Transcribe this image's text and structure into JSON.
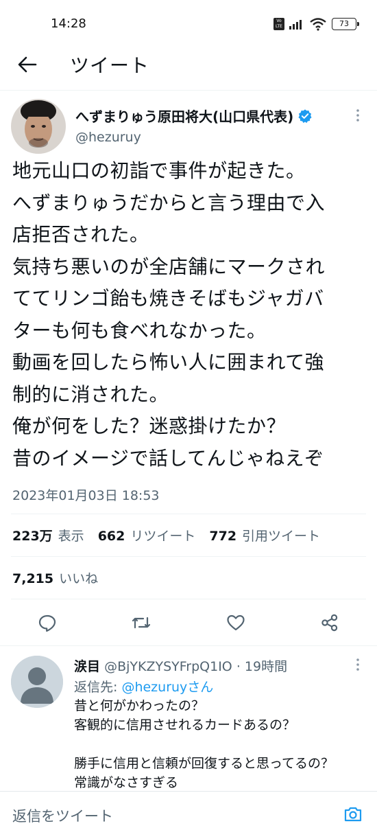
{
  "status_bar": {
    "time": "14:28",
    "volte": "Vo LTE",
    "battery": "73"
  },
  "topbar": {
    "title": "ツイート"
  },
  "tweet": {
    "author_name": "へずまりゅう原田将大(山口県代表)",
    "author_handle": "@hezuruy",
    "lines": [
      "地元山口の初詣で事件が起きた。",
      "へずまりゅうだからと言う理由で入",
      "店拒否された。",
      "気持ち悪いのが全店舗にマークされ",
      "ててリンゴ飴も焼きそばもジャガバ",
      "ターも何も食べれなかった。",
      "動画を回したら怖い人に囲まれて強",
      "制的に消された。",
      "俺が何をした？迷惑掛けたか？",
      "昔のイメージで話してんじゃねえぞ"
    ],
    "timestamp": "2023年01月03日 18:53",
    "stats": {
      "views_count": "223万",
      "views_label": "表示",
      "retweets_count": "662",
      "retweets_label": "リツイート",
      "quotes_count": "772",
      "quotes_label": "引用ツイート",
      "likes_count": "7,215",
      "likes_label": "いいね"
    },
    "accent_color": "#1d9bf0"
  },
  "reply": {
    "name": "涙目",
    "handle": "@BjYKZYSYFrpQ1IO",
    "time": "· 19時間",
    "reply_to_label": "返信先:",
    "reply_to_handle": "@hezuruyさん",
    "lines": [
      "昔と何がかわったの？",
      "客観的に信用させれるカードあるの？",
      "",
      "勝手に信用と信頼が回復すると思ってるの？",
      "常識がなさすぎる"
    ]
  },
  "compose": {
    "placeholder": "返信をツイート"
  },
  "icons": {
    "back": "arrow-left-icon",
    "verified": "verified-badge-icon",
    "more": "more-vertical-icon",
    "reply": "reply-bubble-icon",
    "retweet": "retweet-icon",
    "like": "heart-icon",
    "share": "share-icon",
    "camera": "camera-icon"
  }
}
